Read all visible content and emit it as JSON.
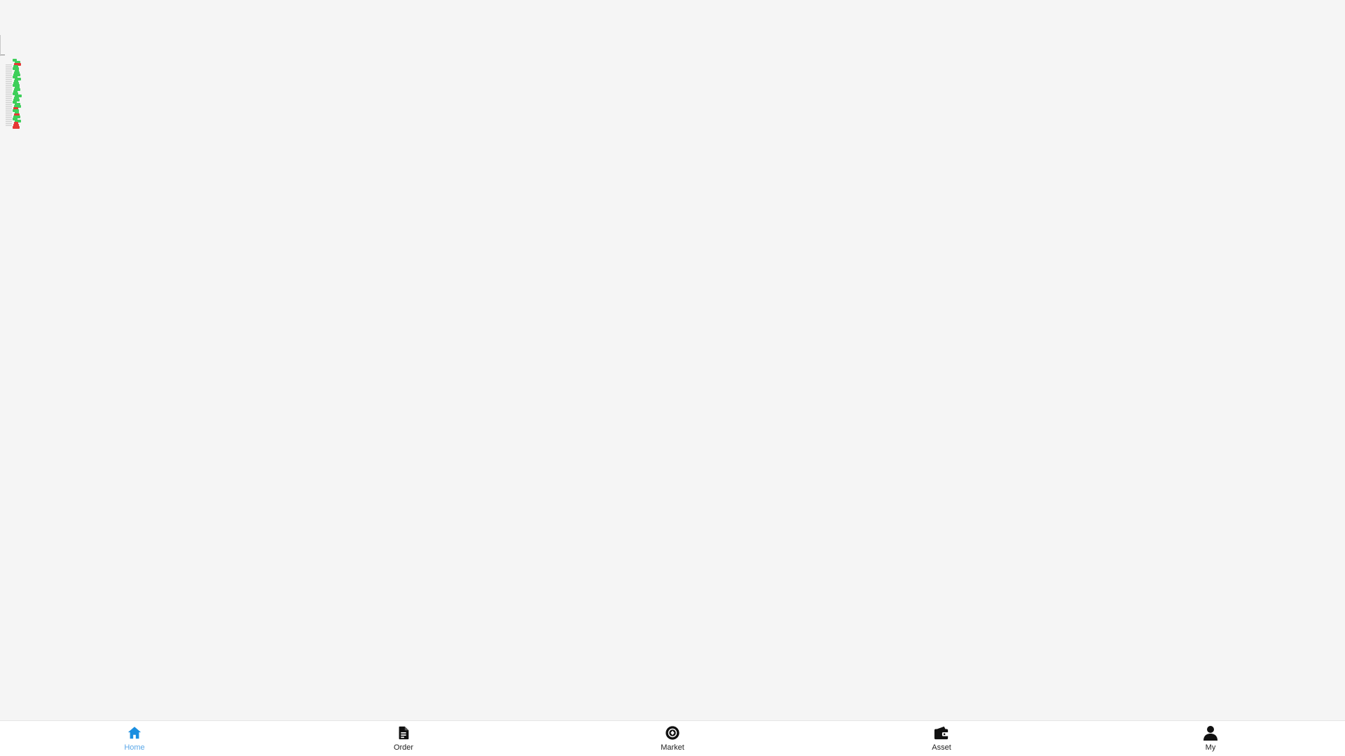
{
  "colors": {
    "background": "#f5f5f5",
    "tabbar_background": "#ffffff",
    "active": "#1a8ee0",
    "active_label": "#5aa7e8",
    "inactive": "#111111",
    "gain": "#3ecf5a",
    "loss": "#e53935"
  },
  "tabbar": {
    "active_tab": "home",
    "tabs": [
      {
        "id": "home",
        "label": "Home",
        "icon": "home-icon"
      },
      {
        "id": "order",
        "label": "Order",
        "icon": "document-icon"
      },
      {
        "id": "market",
        "label": "Market",
        "icon": "market-coin-icon"
      },
      {
        "id": "asset",
        "label": "Asset",
        "icon": "wallet-icon"
      },
      {
        "id": "my",
        "label": "My",
        "icon": "user-icon"
      }
    ]
  }
}
